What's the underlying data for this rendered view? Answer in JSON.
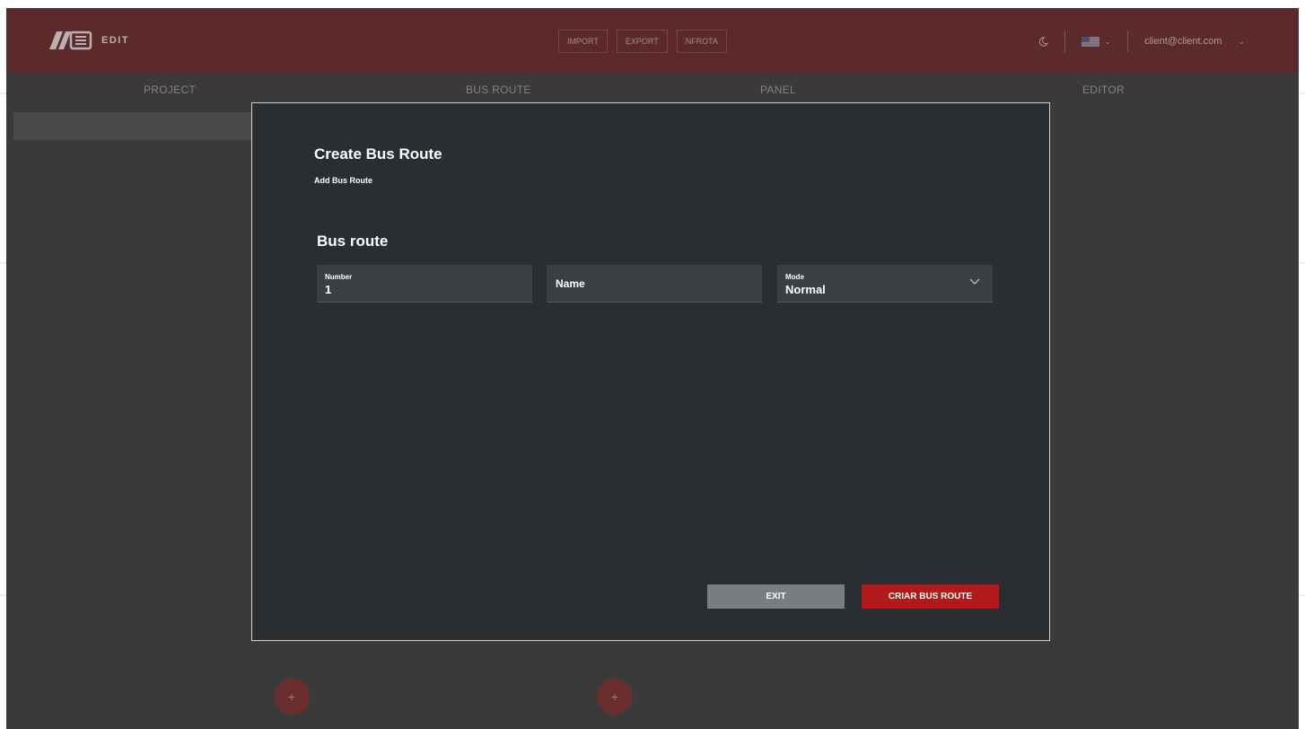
{
  "header": {
    "logo_text": "EDIT",
    "actions": [
      "IMPORT",
      "EXPORT",
      "NFROTA"
    ],
    "theme_icon": "moon-icon",
    "language_icon": "us-flag-icon",
    "user_email": "client@client.com"
  },
  "columns": [
    "PROJECT",
    "BUS ROUTE",
    "PANEL",
    "EDITOR"
  ],
  "fab_label": "+",
  "modal": {
    "title": "Create Bus Route",
    "subtitle": "Add Bus Route",
    "section_title": "Bus route",
    "fields": {
      "number": {
        "label": "Number",
        "value": "1"
      },
      "name": {
        "placeholder": "Name"
      },
      "mode": {
        "label": "Mode",
        "value": "Normal"
      }
    },
    "exit_label": "EXIT",
    "create_label": "CRIAR BUS ROUTE"
  },
  "colors": {
    "header_bg": "#5d2a2c",
    "modal_bg": "#2b2e31",
    "primary_button": "#b3181b",
    "secondary_button": "#7a7d80"
  }
}
